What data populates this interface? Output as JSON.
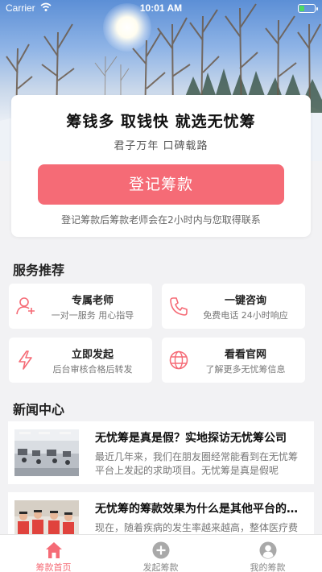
{
  "status_bar": {
    "carrier": "Carrier",
    "time": "10:01 AM"
  },
  "promo": {
    "title": "筹钱多 取钱快 就选无忧筹",
    "subtitle": "君子万年 口碑载路",
    "register_button": "登记筹款",
    "note": "登记筹款后筹款老师会在2小时内与您取得联系"
  },
  "services": {
    "section_title": "服务推荐",
    "items": [
      {
        "title": "专属老师",
        "subtitle": "一对一服务 用心指导",
        "icon": "user-add-icon"
      },
      {
        "title": "一键咨询",
        "subtitle": "免费电话 24小时响应",
        "icon": "phone-icon"
      },
      {
        "title": "立即发起",
        "subtitle": "后台审核合格后转发",
        "icon": "lightning-icon"
      },
      {
        "title": "看看官网",
        "subtitle": "了解更多无忧筹信息",
        "icon": "globe-icon"
      }
    ]
  },
  "news": {
    "section_title": "新闻中心",
    "items": [
      {
        "title": "无忧筹是真是假？实地探访无忧筹公司",
        "excerpt": "最近几年来，我们在朋友圈经常能看到在无忧筹平台上发起的求助项目。无忧筹是真是假呢"
      },
      {
        "title": "无忧筹的筹款效果为什么是其他平台的几倍",
        "excerpt": "现在，随着疾病的发生率越来越高，整体医疗费用也在上涨"
      }
    ]
  },
  "tab_bar": {
    "items": [
      {
        "label": "筹款首页",
        "active": true
      },
      {
        "label": "发起筹款",
        "active": false
      },
      {
        "label": "我的筹款",
        "active": false
      }
    ]
  },
  "colors": {
    "accent": "#f56b76",
    "background": "#f2f2f4"
  }
}
